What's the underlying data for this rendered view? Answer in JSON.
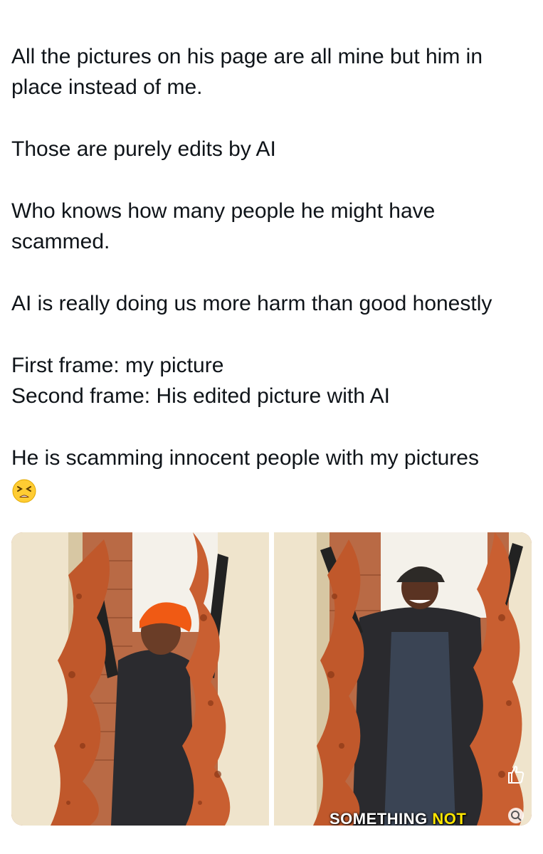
{
  "tweet": {
    "paragraphs": [
      "All the pictures on his page are all mine but him in place instead of me.",
      "Those are purely edits by AI",
      "Who knows how many people he might have scammed.",
      "AI is really doing us more harm than good honestly",
      "First frame: my picture\nSecond frame: His edited picture with AI",
      "He is scamming innocent people with my pictures"
    ],
    "emoji": "tired-face-emoji"
  },
  "media": {
    "left_frame": {
      "subject": "woman-with-orange-cap-holding-meat-strips"
    },
    "right_frame": {
      "subject": "man-with-black-cap-holding-meat-strips",
      "caption_part1": "SOMETHING ",
      "caption_part2": "NOT",
      "overlay_icons": [
        "thumbs-up-icon",
        "search-icon"
      ]
    }
  }
}
